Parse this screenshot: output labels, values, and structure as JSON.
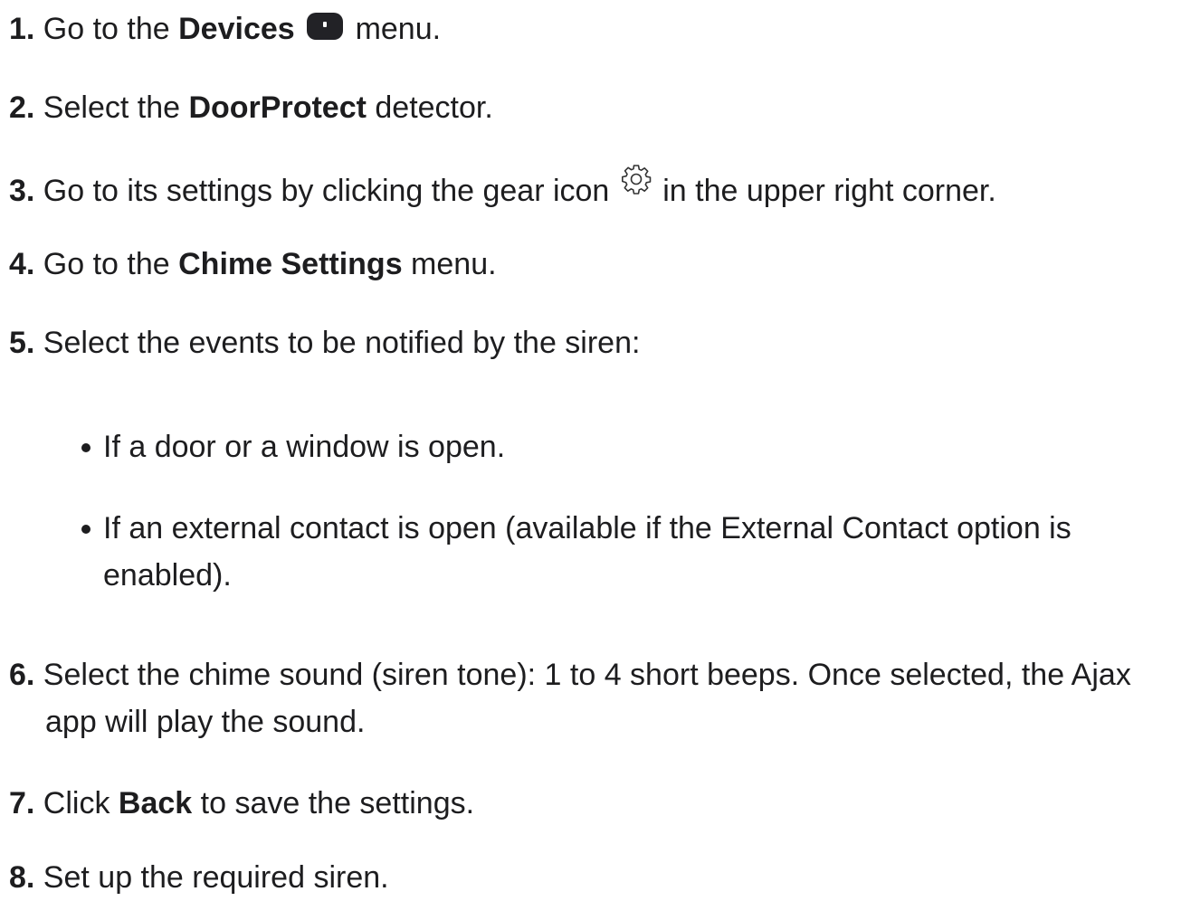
{
  "steps": [
    {
      "num": "1.",
      "pre": " Go to the ",
      "bold": "Devices",
      "post": " menu."
    },
    {
      "num": "2.",
      "pre": " Select the ",
      "bold": "DoorProtect",
      "post": " detector."
    },
    {
      "num": "3.",
      "pre": " Go to its settings by clicking the gear icon ",
      "post": " in the upper right corner."
    },
    {
      "num": "4.",
      "pre": " Go to the ",
      "bold": "Chime Settings",
      "post": " menu."
    },
    {
      "num": "5.",
      "text": " Select the events to be notified by the siren:"
    },
    {
      "num": "6.",
      "line1": " Select the chime sound (siren tone): 1 to 4 short beeps. Once selected, the Ajax",
      "line2": "app will play the sound."
    },
    {
      "num": "7.",
      "pre": " Click ",
      "bold": "Back",
      "post": " to save the settings."
    },
    {
      "num": "8.",
      "text": " Set up the required siren."
    }
  ],
  "bullets": [
    {
      "text": "If a door or a window is open."
    },
    {
      "line1": "If an external contact is open (available if the External Contact option is",
      "line2": "enabled)."
    }
  ],
  "icons": {
    "devices": "devices-icon",
    "gear": "gear-icon"
  }
}
